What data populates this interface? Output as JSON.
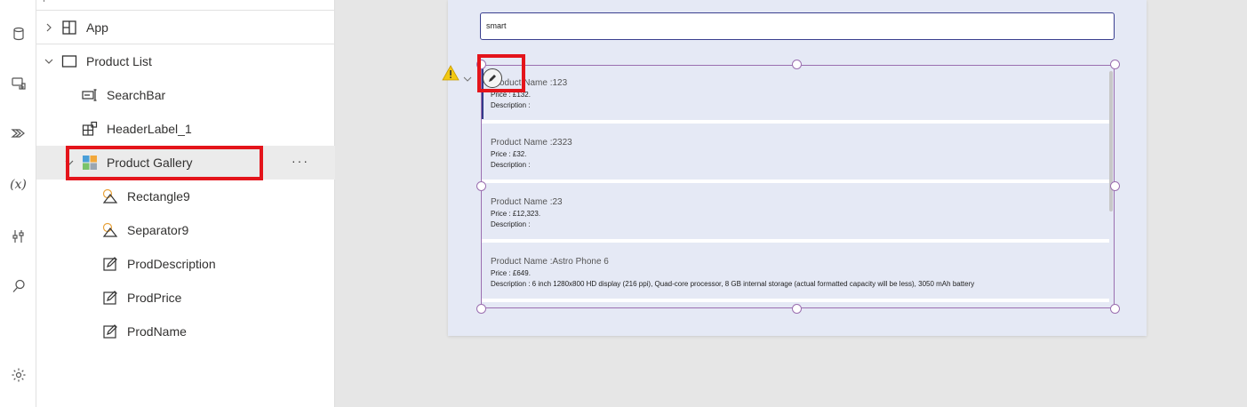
{
  "tree": {
    "items": [
      {
        "label": "App",
        "icon": "app-icon",
        "expanded": false
      },
      {
        "label": "Product List",
        "icon": "screen-icon",
        "expanded": true
      },
      {
        "label": "SearchBar",
        "icon": "text-input-icon"
      },
      {
        "label": "HeaderLabel_1",
        "icon": "container-icon"
      },
      {
        "label": "Product Gallery",
        "icon": "gallery-icon",
        "selected": true,
        "more": "···"
      },
      {
        "label": "Rectangle9",
        "icon": "shapes-icon"
      },
      {
        "label": "Separator9",
        "icon": "shapes-icon"
      },
      {
        "label": "ProdDescription",
        "icon": "label-edit-icon"
      },
      {
        "label": "ProdPrice",
        "icon": "label-edit-icon"
      },
      {
        "label": "ProdName",
        "icon": "label-edit-icon"
      }
    ]
  },
  "rail": {
    "icons": [
      "data-icon",
      "media-icon",
      "power-automate-icon",
      "variables-icon",
      "advanced-tools-icon",
      "search-icon",
      "settings-icon"
    ],
    "variables_glyph": "(x)"
  },
  "canvas": {
    "search_value": "smart",
    "gallery": [
      {
        "name": "Product Name :123",
        "price": "Price :  £132.",
        "description": "Description  :"
      },
      {
        "name": "Product Name :2323",
        "price": "Price :  £32.",
        "description": "Description  :"
      },
      {
        "name": "Product Name :23",
        "price": "Price :  £12,323.",
        "description": "Description  :"
      },
      {
        "name": "Product Name :Astro Phone 6",
        "price": "Price :  £649.",
        "description": "Description  :  6 inch 1280x800 HD display (216 ppi), Quad-core processor, 8 GB internal storage (actual formatted capacity will be less), 3050 mAh battery"
      }
    ]
  },
  "colors": {
    "highlight": "#e4141b",
    "selection": "#9b6fb0",
    "warning": "#f2c811",
    "screen_bg": "#e5e9f5"
  }
}
